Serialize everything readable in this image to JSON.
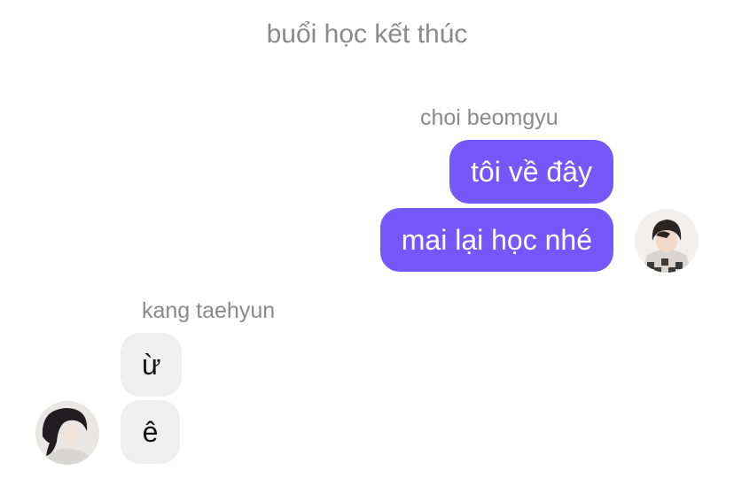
{
  "chat": {
    "system_message": "buổi học kết thúc",
    "outgoing_group": {
      "sender": "choi beomgyu",
      "messages": [
        "tôi về đây",
        "mai lại học nhé"
      ],
      "avatar_icon": "user-avatar-photo"
    },
    "incoming_group": {
      "sender": "kang taehyun",
      "messages": [
        "ừ",
        "ê"
      ],
      "avatar_icon": "user-avatar-photo"
    }
  },
  "colors": {
    "outgoing_bubble": "#7458fb",
    "incoming_bubble": "#efefef",
    "meta_text": "#8a8a8e"
  }
}
